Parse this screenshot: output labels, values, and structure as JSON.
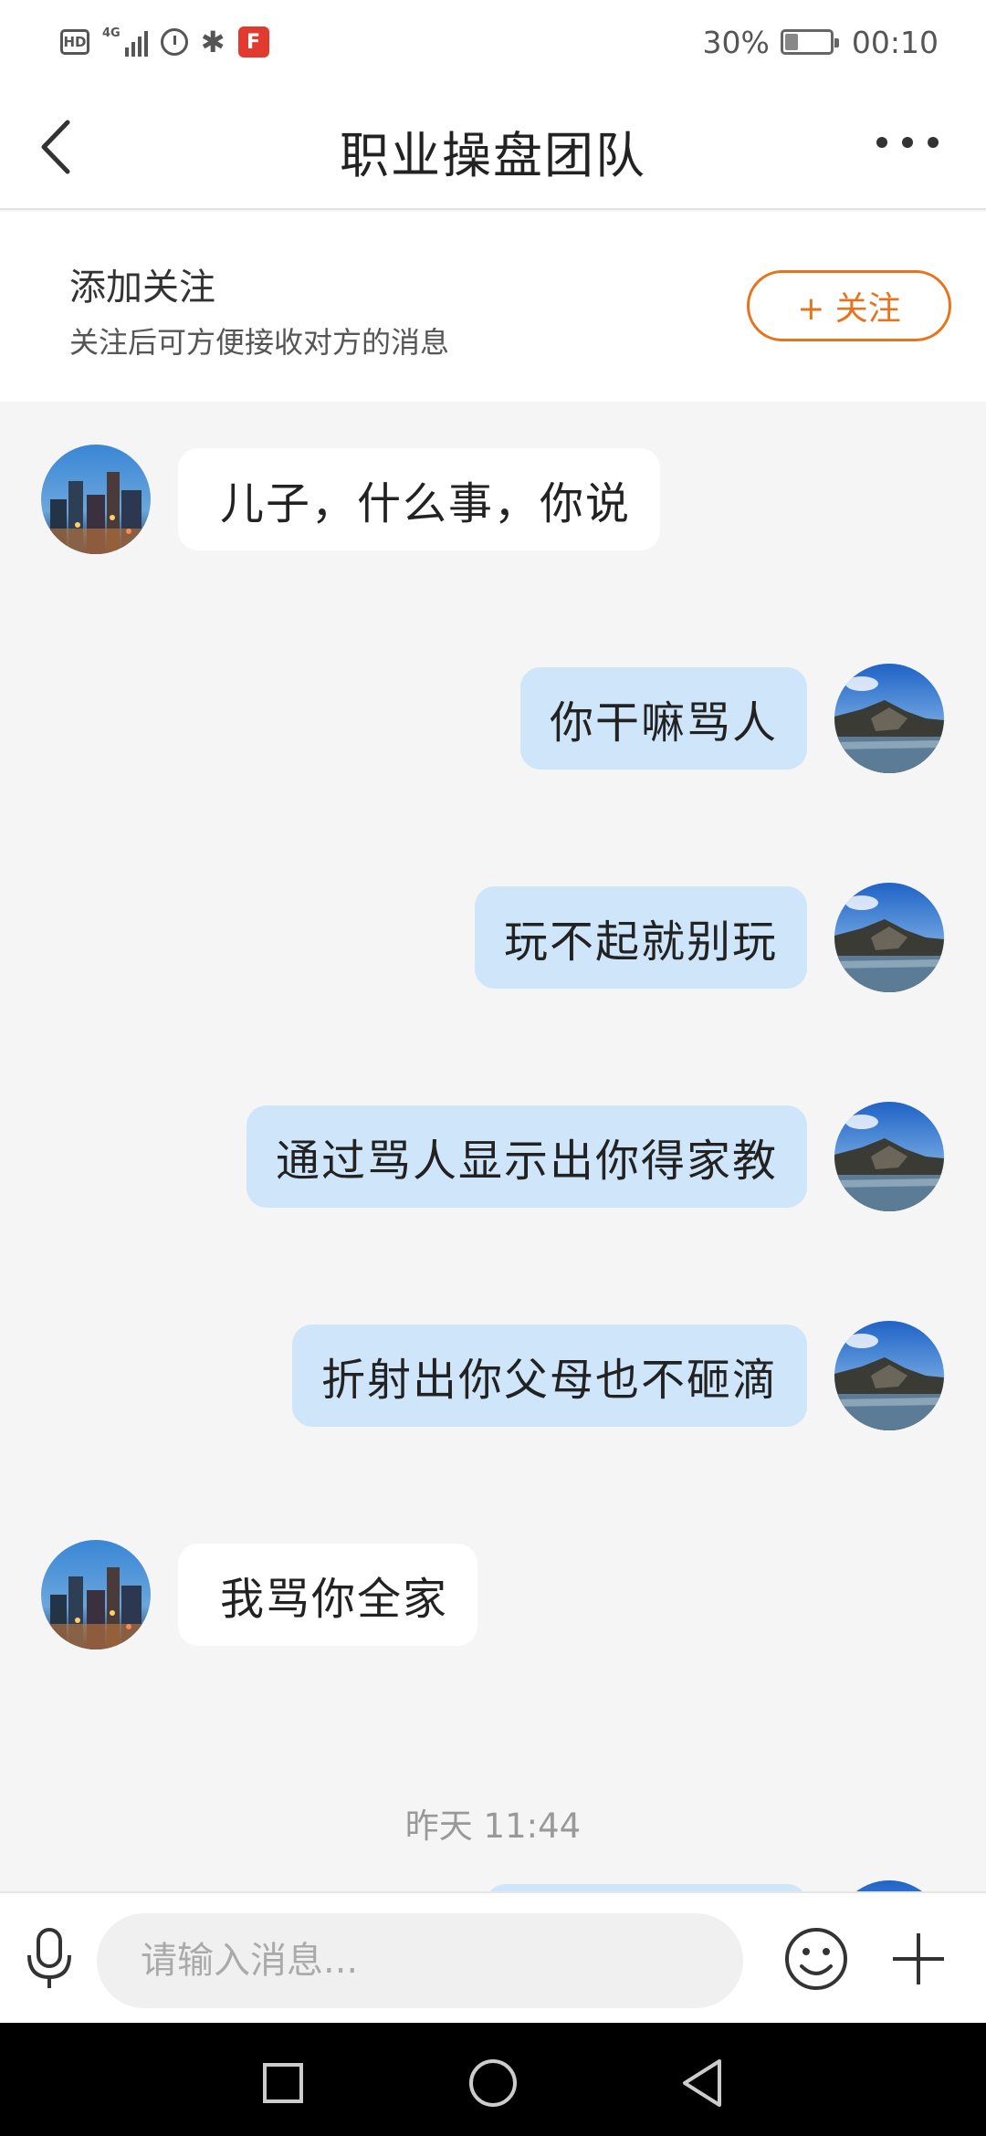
{
  "status_bar": {
    "hd_label": "HD",
    "network_label": "4G",
    "battery_percent": "30%",
    "battery_level": 0.3,
    "time": "00:10"
  },
  "header": {
    "title": "职业操盘团队"
  },
  "follow_bar": {
    "title": "添加关注",
    "subtitle": "关注后可方便接收对方的消息",
    "button_label": "+ 关注"
  },
  "messages": [
    {
      "side": "in",
      "text": "儿子，什么事，你说"
    },
    {
      "side": "out",
      "text": "你干嘛骂人"
    },
    {
      "side": "out",
      "text": "玩不起就别玩"
    },
    {
      "side": "out",
      "text": "通过骂人显示出你得家教"
    },
    {
      "side": "out",
      "text": "折射出你父母也不砸滴"
    },
    {
      "side": "in",
      "text": "我骂你全家"
    }
  ],
  "time_separator": "昨天 11:44",
  "input_bar": {
    "placeholder": "请输入消息..."
  },
  "colors": {
    "accent": "#e8731d",
    "outgoing_bubble": "#cfe5fa",
    "incoming_bubble": "#ffffff",
    "background": "#f5f5f5"
  },
  "icons": [
    "back-icon",
    "more-icon",
    "microphone-icon",
    "emoji-icon",
    "plus-icon",
    "nav-recents-icon",
    "nav-home-icon",
    "nav-back-icon"
  ]
}
